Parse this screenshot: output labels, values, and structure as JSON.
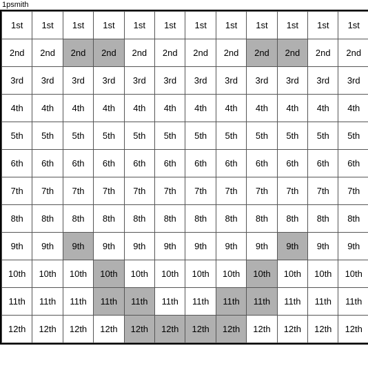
{
  "title": "1psmith",
  "rows": [
    {
      "label": "1st",
      "highlights": [
        false,
        false,
        false,
        false,
        false,
        false,
        false,
        false,
        false,
        false,
        false,
        false
      ]
    },
    {
      "label": "2nd",
      "highlights": [
        false,
        false,
        true,
        true,
        false,
        false,
        false,
        false,
        true,
        true,
        false,
        false
      ]
    },
    {
      "label": "3rd",
      "highlights": [
        false,
        false,
        false,
        false,
        false,
        false,
        false,
        false,
        false,
        false,
        false,
        false
      ]
    },
    {
      "label": "4th",
      "highlights": [
        false,
        false,
        false,
        false,
        false,
        false,
        false,
        false,
        false,
        false,
        false,
        false
      ]
    },
    {
      "label": "5th",
      "highlights": [
        false,
        false,
        false,
        false,
        false,
        false,
        false,
        false,
        false,
        false,
        false,
        false
      ]
    },
    {
      "label": "6th",
      "highlights": [
        false,
        false,
        false,
        false,
        false,
        false,
        false,
        false,
        false,
        false,
        false,
        false
      ]
    },
    {
      "label": "7th",
      "highlights": [
        false,
        false,
        false,
        false,
        false,
        false,
        false,
        false,
        false,
        false,
        false,
        false
      ]
    },
    {
      "label": "8th",
      "highlights": [
        false,
        false,
        false,
        false,
        false,
        false,
        false,
        false,
        false,
        false,
        false,
        false
      ]
    },
    {
      "label": "9th",
      "highlights": [
        false,
        false,
        true,
        false,
        false,
        false,
        false,
        false,
        false,
        true,
        false,
        false
      ]
    },
    {
      "label": "10th",
      "highlights": [
        false,
        false,
        false,
        true,
        false,
        false,
        false,
        false,
        true,
        false,
        false,
        false
      ]
    },
    {
      "label": "11th",
      "highlights": [
        false,
        false,
        false,
        true,
        true,
        false,
        false,
        true,
        true,
        false,
        false,
        false
      ]
    },
    {
      "label": "12th",
      "highlights": [
        false,
        false,
        false,
        false,
        true,
        true,
        true,
        true,
        false,
        false,
        false,
        false
      ]
    }
  ],
  "cols": 12
}
